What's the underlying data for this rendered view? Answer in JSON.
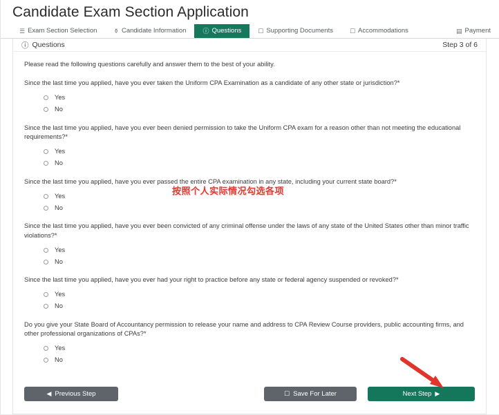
{
  "header": {
    "title": "Candidate Exam Section Application"
  },
  "tabs": [
    {
      "label": "Exam Section Selection",
      "icon": "list-icon",
      "glyph": "☰",
      "active": false
    },
    {
      "label": "Candidate Information",
      "icon": "user-icon",
      "glyph": "⚱",
      "active": false
    },
    {
      "label": "Questions",
      "icon": "question-circle-icon",
      "glyph": "ⓘ",
      "active": true
    },
    {
      "label": "Supporting Documents",
      "icon": "folder-icon",
      "glyph": "☐",
      "active": false
    },
    {
      "label": "Accommodations",
      "icon": "clipboard-icon",
      "glyph": "☐",
      "active": false
    },
    {
      "label": "Payment",
      "icon": "credit-card-icon",
      "glyph": "▤",
      "active": false
    }
  ],
  "card": {
    "section_title": "Questions",
    "section_icon_glyph": "ⓘ",
    "step_label": "Step 3 of 6",
    "intro": "Please read the following questions carefully and answer them to the best of your ability."
  },
  "questions": [
    {
      "text": "Since the last time you applied, have you ever taken the Uniform CPA Examination as a candidate of any other state or jurisdiction?*",
      "options": [
        "Yes",
        "No"
      ],
      "selected": null
    },
    {
      "text": "Since the last time you applied, have you ever been denied permission to take the Uniform CPA exam for a reason other than not meeting the educational requirements?*",
      "options": [
        "Yes",
        "No"
      ],
      "selected": null
    },
    {
      "text": "Since the last time you applied, have you ever passed the entire CPA examination in any state, including your current state board?*",
      "options": [
        "Yes",
        "No"
      ],
      "selected": null
    },
    {
      "text": "Since the last time you applied, have you ever been convicted of any criminal offense under the laws of any state of the United States other than minor traffic violations?*",
      "options": [
        "Yes",
        "No"
      ],
      "selected": null
    },
    {
      "text": "Since the last time you applied, have you ever had your right to practice before any state or federal agency suspended or revoked?*",
      "options": [
        "Yes",
        "No"
      ],
      "selected": null
    },
    {
      "text": "Do you give your State Board of Accountancy permission to release your name and address to CPA Review Course providers, public accounting firms, and other professional organizations of CPAs?*",
      "options": [
        "Yes",
        "No"
      ],
      "selected": null
    }
  ],
  "footer": {
    "previous_label": "Previous Step",
    "previous_glyph": "◀",
    "save_label": "Save For Later",
    "save_glyph": "☐",
    "next_label": "Next Step",
    "next_glyph": "▶"
  },
  "annotations": {
    "chinese_note": "按照个人实际情况勾选各项",
    "arrow_target": "next-step-button"
  },
  "colors": {
    "accent_green": "#15795d",
    "button_grey": "#5e6469",
    "annotation_red": "#e03a32",
    "text": "#3c3c3c"
  }
}
